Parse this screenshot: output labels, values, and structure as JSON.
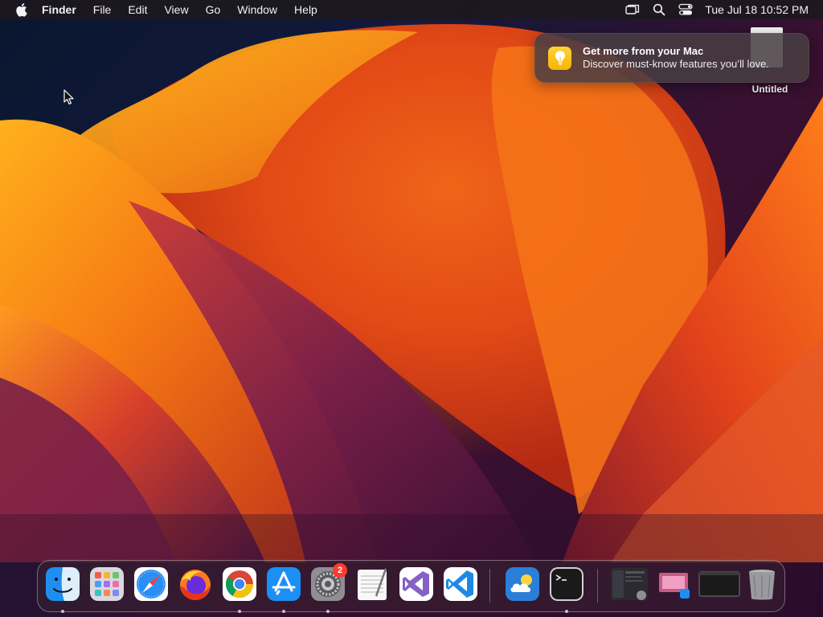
{
  "menubar": {
    "items": [
      {
        "label": "Finder",
        "bold": true
      },
      {
        "label": "File"
      },
      {
        "label": "Edit"
      },
      {
        "label": "View"
      },
      {
        "label": "Go"
      },
      {
        "label": "Window"
      },
      {
        "label": "Help"
      }
    ],
    "status_icons": [
      "screen-mirroring-icon",
      "spotlight-search-icon",
      "control-center-icon"
    ],
    "clock": "Tue Jul 18  10:52 PM"
  },
  "notification": {
    "app_icon": "tips-lightbulb-icon",
    "title": "Get more from your Mac",
    "body": "Discover must-know features you’ll love."
  },
  "desktop": {
    "file_label": "Untitled"
  },
  "dock": {
    "apps": [
      {
        "id": "finder",
        "icon": "finder-icon",
        "running": true
      },
      {
        "id": "launchpad",
        "icon": "launchpad-icon",
        "running": false
      },
      {
        "id": "safari",
        "icon": "safari-icon",
        "running": false
      },
      {
        "id": "firefox",
        "icon": "firefox-icon",
        "running": false
      },
      {
        "id": "chrome",
        "icon": "chrome-icon",
        "running": true
      },
      {
        "id": "app-store",
        "icon": "app-store-icon",
        "running": true
      },
      {
        "id": "system-settings",
        "icon": "system-settings-icon",
        "running": true,
        "badge": "2"
      },
      {
        "id": "textedit",
        "icon": "textedit-icon",
        "running": false
      },
      {
        "id": "visual-studio",
        "icon": "visual-studio-icon",
        "running": false
      },
      {
        "id": "vscode",
        "icon": "vscode-icon",
        "running": false
      },
      {
        "id": "weather",
        "icon": "weather-icon",
        "running": false
      },
      {
        "id": "terminal",
        "icon": "terminal-icon",
        "running": true
      },
      {
        "id": "recent-window-1",
        "icon": "window-thumbnail-icon",
        "running": false
      },
      {
        "id": "recent-window-2",
        "icon": "window-thumbnail-icon",
        "running": false
      },
      {
        "id": "recent-window-3",
        "icon": "window-thumbnail-icon",
        "running": false
      },
      {
        "id": "trash",
        "icon": "trash-icon",
        "running": false
      }
    ]
  },
  "colors": {
    "accent_orange": "#f2781a",
    "badge_red": "#ff3b30",
    "tips_yellow": "#ffcc00"
  }
}
